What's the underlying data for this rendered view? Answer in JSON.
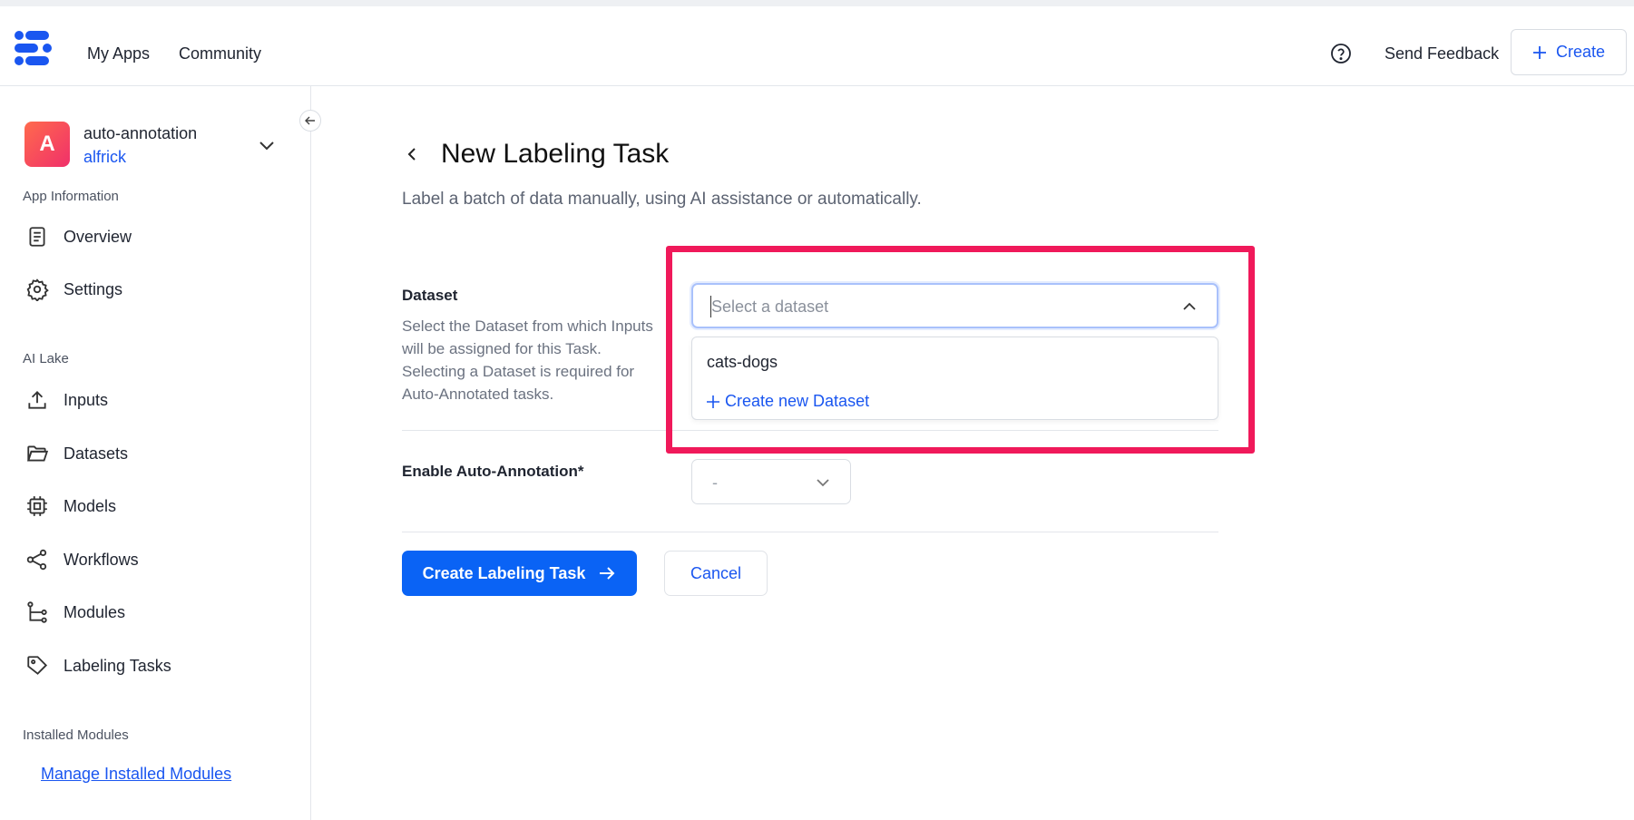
{
  "topbar": {
    "logo_icon": "clarifai-logo-icon",
    "nav": [
      "My Apps",
      "Community"
    ],
    "help_icon": "question-circle-icon",
    "send_feedback": "Send Feedback",
    "create_label": "Create"
  },
  "sidebar": {
    "collapse_icon": "arrow-left-icon",
    "app": {
      "avatar_letter": "A",
      "name": "auto-annotation",
      "owner": "alfrick"
    },
    "sections": {
      "app_information": "App Information",
      "ai_lake": "AI Lake",
      "installed_modules": "Installed Modules"
    },
    "items": [
      {
        "label": "Overview",
        "icon": "document-icon"
      },
      {
        "label": "Settings",
        "icon": "gear-icon"
      },
      {
        "label": "Inputs",
        "icon": "upload-icon"
      },
      {
        "label": "Datasets",
        "icon": "folder-icon"
      },
      {
        "label": "Models",
        "icon": "chip-icon"
      },
      {
        "label": "Workflows",
        "icon": "share-nodes-icon"
      },
      {
        "label": "Modules",
        "icon": "tree-icon"
      },
      {
        "label": "Labeling Tasks",
        "icon": "tag-icon"
      }
    ],
    "manage_modules": "Manage Installed Modules"
  },
  "main": {
    "title": "New Labeling Task",
    "subtitle": "Label a batch of data manually, using AI assistance or automatically.",
    "dataset": {
      "label": "Dataset",
      "help": "Select the Dataset from which Inputs will be assigned for this Task. Selecting a Dataset is required for Auto-Annotated tasks.",
      "placeholder": "Select a dataset",
      "options": [
        "cats-dogs"
      ],
      "create_new": "Create new Dataset"
    },
    "auto_annotation": {
      "label": "Enable Auto-Annotation*",
      "value": "-"
    },
    "primary_button": "Create Labeling Task",
    "cancel_button": "Cancel"
  },
  "colors": {
    "accent": "#0a63f5",
    "link": "#1a56f0",
    "highlight": "#f0195a"
  }
}
